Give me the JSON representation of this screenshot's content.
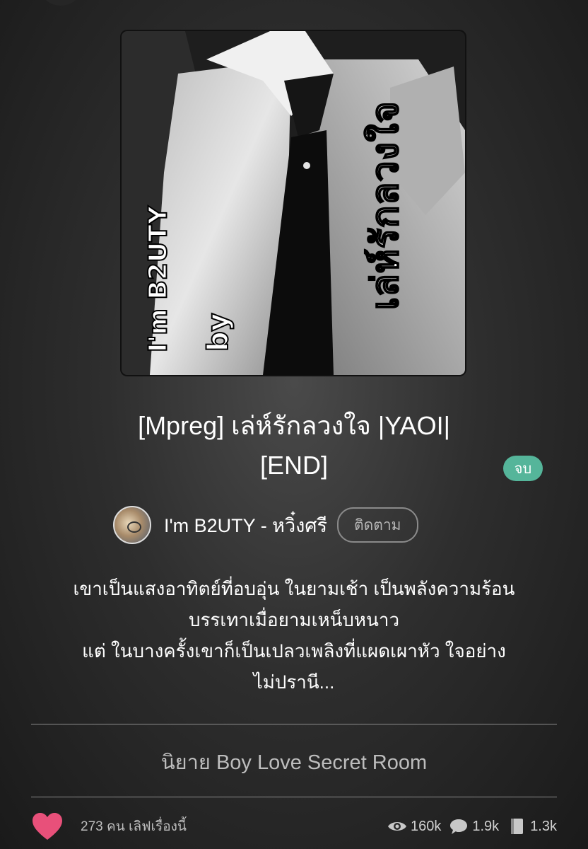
{
  "cover": {
    "title_text": "เล่ห์รักลวงใจ",
    "by_text": "by",
    "author_text": "I'm B2UTY"
  },
  "story": {
    "title_line1": "[Mpreg] เล่ห์รักลวงใจ |YAOI|",
    "title_line2": "[END]",
    "status_badge": "จบ",
    "status_color": "#55b59a"
  },
  "author": {
    "name": "I'm B2UTY - หวิ๋งศรี",
    "follow_label": "ติดตาม"
  },
  "synopsis": {
    "line1": "เขาเป็นแสงอาทิตย์ที่อบอุ่น ในยามเช้า เป็นพลังความร้อน",
    "line2": "บรรเทาเมื่อยามเหน็บหนาว",
    "line3": "แต่ ในบางครั้งเขาก็เป็นเปลวเพลิงที่แผดเผาหัว ใจอย่าง",
    "line4": "ไม่ปรานี..."
  },
  "category": "นิยาย Boy Love Secret Room",
  "stats": {
    "likes_text": "273 คน เลิฟเรื่องนี้",
    "views": "160k",
    "comments": "1.9k",
    "chapters": "1.3k",
    "heart_color": "#e8507a"
  },
  "icons": [
    "heart-icon",
    "eye-icon",
    "comment-icon",
    "book-icon"
  ]
}
